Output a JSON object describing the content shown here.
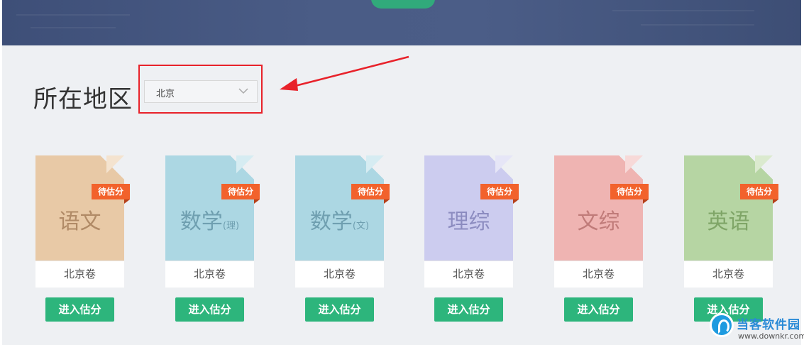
{
  "region": {
    "label": "所在地区",
    "selected": "北京",
    "chevron_icon": "chevron-down-icon"
  },
  "annotation": {
    "highlight_color": "#e8222a"
  },
  "subjects": [
    {
      "name": "语文",
      "suffix": "",
      "badge": "待估分",
      "paper": "北京卷",
      "button": "进入估分",
      "color": "#e8c9a6",
      "fold": "#f4e3cf",
      "text_color": "#b08a66"
    },
    {
      "name": "数学",
      "suffix": "(理)",
      "badge": "待估分",
      "paper": "北京卷",
      "button": "进入估分",
      "color": "#acd7e3",
      "fold": "#d6ecf2",
      "text_color": "#6f9fb0"
    },
    {
      "name": "数学",
      "suffix": "(文)",
      "badge": "待估分",
      "paper": "北京卷",
      "button": "进入估分",
      "color": "#acd7e3",
      "fold": "#d6ecf2",
      "text_color": "#6f9fb0"
    },
    {
      "name": "理综",
      "suffix": "",
      "badge": "待估分",
      "paper": "北京卷",
      "button": "进入估分",
      "color": "#ccccef",
      "fold": "#e6e6f7",
      "text_color": "#8c8cc0"
    },
    {
      "name": "文综",
      "suffix": "",
      "badge": "待估分",
      "paper": "北京卷",
      "button": "进入估分",
      "color": "#efb4b2",
      "fold": "#f7d9d8",
      "text_color": "#c07b79"
    },
    {
      "name": "英语",
      "suffix": "",
      "badge": "待估分",
      "paper": "北京卷",
      "button": "进入估分",
      "color": "#b6d5a3",
      "fold": "#dbeacf",
      "text_color": "#7fa567"
    }
  ],
  "watermark": {
    "title": "当客软件园",
    "url": "www.downkr.com"
  },
  "colors": {
    "badge": "#f2622c",
    "button": "#2db57c",
    "banner": "#44567f",
    "background": "#eef0f3"
  }
}
